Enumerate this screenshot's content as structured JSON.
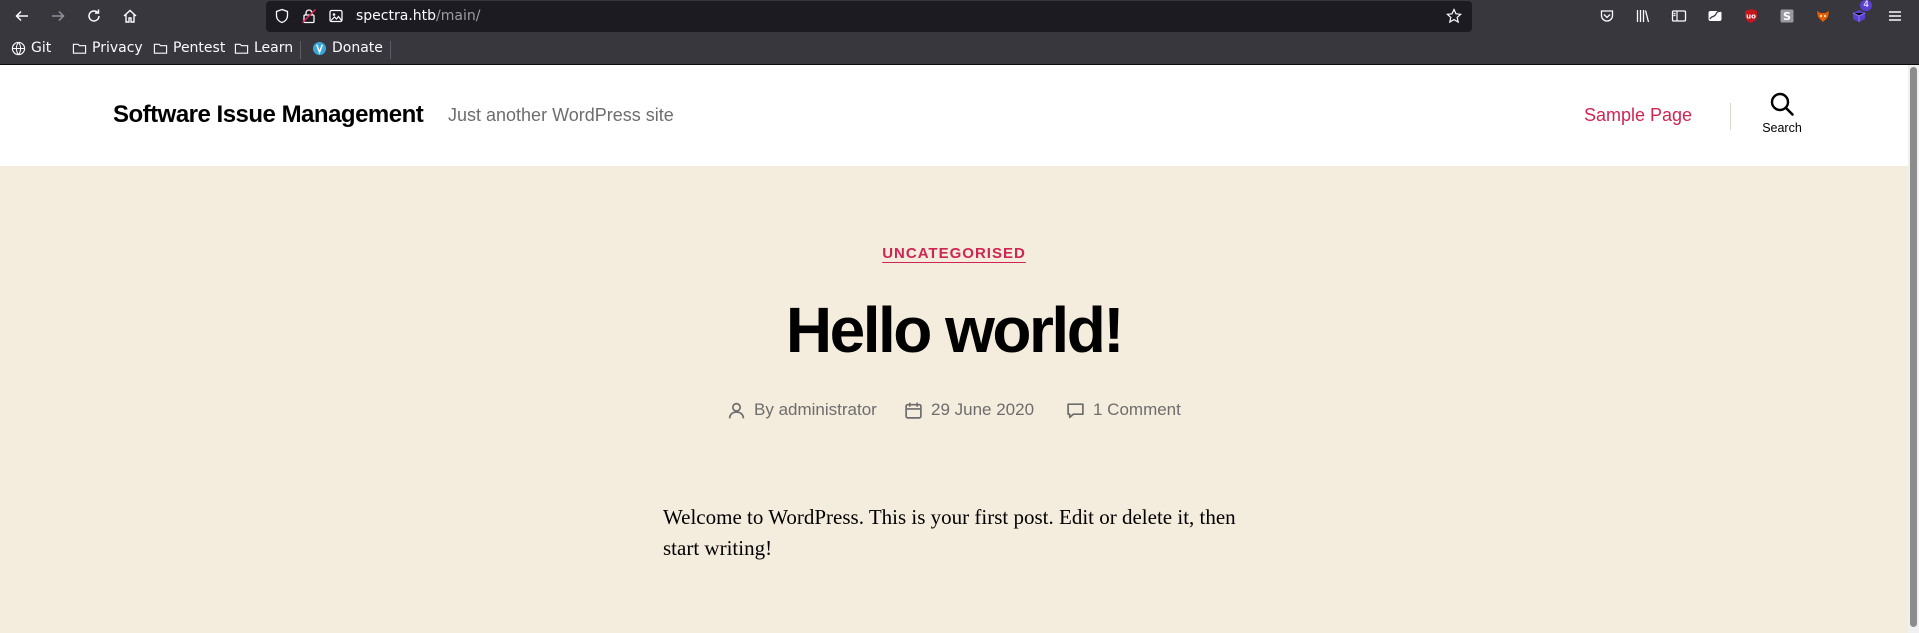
{
  "browser": {
    "url_host": "spectra.htb",
    "url_path": "/main/",
    "toolbar_icons": [
      "back-icon",
      "forward-icon",
      "reload-icon",
      "home-icon"
    ],
    "url_icons": [
      "tracking-protection-icon",
      "not-secure-lock-icon",
      "page-info-icon",
      "bookmark-star-icon"
    ],
    "extensions": [
      {
        "name": "pocket-icon"
      },
      {
        "name": "library-icon"
      },
      {
        "name": "sidebar-icon"
      },
      {
        "name": "extension-pattern-icon"
      },
      {
        "name": "ublock-icon",
        "label": "uo",
        "color": "#c4161c"
      },
      {
        "name": "s-extension-icon",
        "label": "S",
        "color": "#9a9aa0"
      },
      {
        "name": "fox-extension-icon",
        "color": "#e66000"
      },
      {
        "name": "cube-extension-icon",
        "badge": "4",
        "color": "#5b3fd1"
      },
      {
        "name": "menu-icon"
      }
    ]
  },
  "bookmarks": [
    {
      "label": "Git",
      "icon": "globe-icon"
    },
    {
      "label": "Privacy",
      "icon": "folder-icon"
    },
    {
      "label": "Pentest",
      "icon": "folder-icon"
    },
    {
      "label": "Learn",
      "icon": "folder-icon"
    },
    {
      "label": "Donate",
      "icon": "donate-logo-icon"
    }
  ],
  "site": {
    "title": "Software Issue Management",
    "description": "Just another WordPress site",
    "nav": [
      "Sample Page"
    ],
    "search_label": "Search",
    "accent_color": "#cd2653",
    "background_color": "#f4ecdd"
  },
  "post": {
    "category": "UNCATEGORISED",
    "title": "Hello world!",
    "author_prefix": "By ",
    "author": "administrator",
    "date": "29 June 2020",
    "comments": "1 Comment",
    "content": "Welcome to WordPress. This is your first post. Edit or delete it, then start writing!"
  }
}
